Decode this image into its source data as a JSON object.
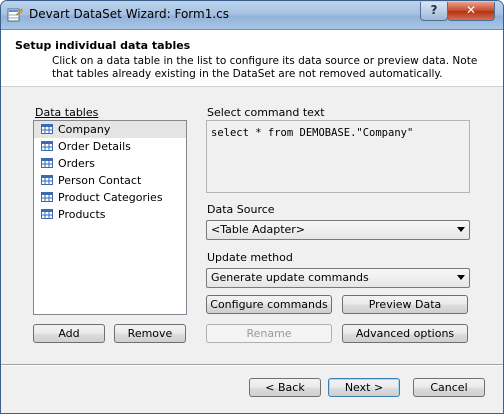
{
  "window": {
    "title": "Devart DataSet Wizard: Form1.cs",
    "help_label": "?",
    "close_label": "✕"
  },
  "header": {
    "title": "Setup individual data tables",
    "description": "Click on a data table in the list to configure its data source or preview data. Note that tables already existing in the DataSet are not removed automatically."
  },
  "tables": {
    "label": "Data tables",
    "items": [
      {
        "label": "Company",
        "selected": true
      },
      {
        "label": "Order Details"
      },
      {
        "label": "Orders"
      },
      {
        "label": "Person Contact"
      },
      {
        "label": "Product Categories"
      },
      {
        "label": "Products"
      }
    ],
    "add_label": "Add",
    "remove_label": "Remove"
  },
  "command": {
    "label": "Select command text",
    "text": "select * from DEMOBASE.\"Company\""
  },
  "data_source": {
    "label": "Data Source",
    "value": "<Table Adapter>"
  },
  "update_method": {
    "label": "Update method",
    "value": "Generate update commands"
  },
  "actions": {
    "configure_label": "Configure commands",
    "preview_label": "Preview Data",
    "rename_label": "Rename",
    "advanced_label": "Advanced options"
  },
  "footer": {
    "back_label": "< Back",
    "next_label": "Next >",
    "cancel_label": "Cancel"
  },
  "colors": {
    "title_bar": "#a7c2e2",
    "close_button": "#c7462a",
    "selected_row": "#e5e5e5"
  }
}
